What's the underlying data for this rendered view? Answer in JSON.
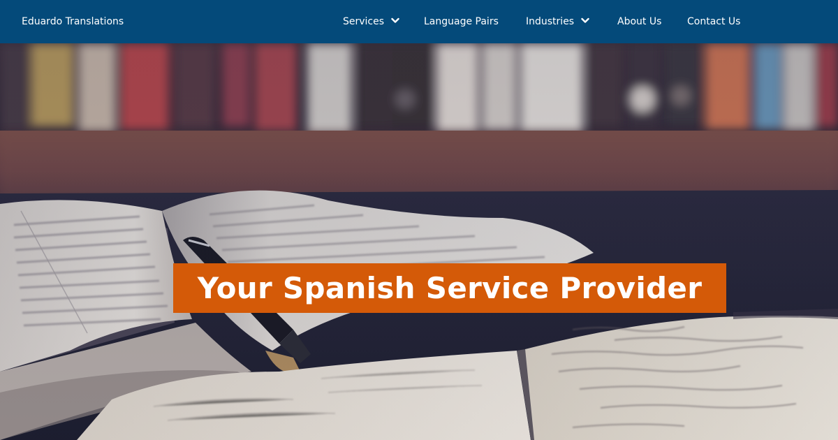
{
  "brand": "Eduardo Translations",
  "nav": {
    "services": "Services",
    "language_pairs": "Language Pairs",
    "industries": "Industries",
    "about": "About Us",
    "contact": "Contact Us"
  },
  "hero": {
    "title": "Your Spanish Service Provider"
  },
  "colors": {
    "navbar": "#044a7a",
    "title_bg": "#d45a08",
    "text": "#ffffff"
  },
  "icons": {
    "dropdown": "chevron-down-icon",
    "background": "open-books-photo"
  }
}
